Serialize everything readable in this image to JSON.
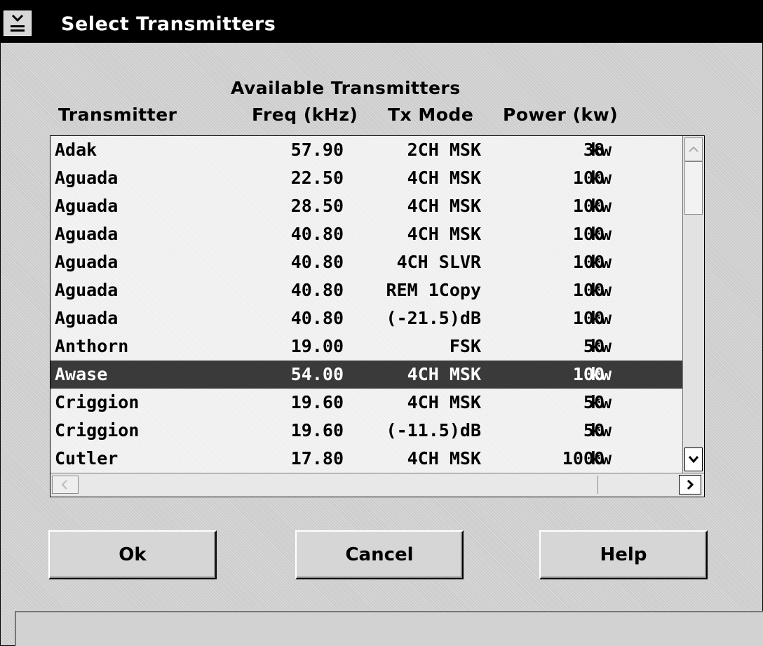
{
  "window": {
    "title": "Select Transmitters"
  },
  "list": {
    "group_title": "Available Transmitters",
    "headers": {
      "transmitter": "Transmitter",
      "freq": "Freq (kHz)",
      "mode": "Tx Mode",
      "power": "Power (kw)"
    },
    "rows": [
      {
        "name": "Adak",
        "freq": "57.90",
        "mode": "2CH MSK",
        "power": "38",
        "unit": "kw"
      },
      {
        "name": "Aguada",
        "freq": "22.50",
        "mode": "4CH MSK",
        "power": "100",
        "unit": "kw"
      },
      {
        "name": "Aguada",
        "freq": "28.50",
        "mode": "4CH MSK",
        "power": "100",
        "unit": "kw"
      },
      {
        "name": "Aguada",
        "freq": "40.80",
        "mode": "4CH MSK",
        "power": "100",
        "unit": "kw"
      },
      {
        "name": "Aguada",
        "freq": "40.80",
        "mode": "4CH SLVR",
        "power": "100",
        "unit": "kw"
      },
      {
        "name": "Aguada",
        "freq": "40.80",
        "mode": "REM 1Copy",
        "power": "100",
        "unit": "kw"
      },
      {
        "name": "Aguada",
        "freq": "40.80",
        "mode": "(-21.5)dB",
        "power": "100",
        "unit": "kw"
      },
      {
        "name": "Anthorn",
        "freq": "19.00",
        "mode": "FSK",
        "power": "50",
        "unit": "kw"
      },
      {
        "name": "Awase",
        "freq": "54.00",
        "mode": "4CH MSK",
        "power": "100",
        "unit": "kw"
      },
      {
        "name": "Criggion",
        "freq": "19.60",
        "mode": "4CH MSK",
        "power": "50",
        "unit": "kw"
      },
      {
        "name": "Criggion",
        "freq": "19.60",
        "mode": "(-11.5)dB",
        "power": "50",
        "unit": "kw"
      },
      {
        "name": "Cutler",
        "freq": "17.80",
        "mode": "4CH MSK",
        "power": "1000",
        "unit": "kw"
      }
    ],
    "selected_index": 8
  },
  "buttons": {
    "ok": "Ok",
    "cancel": "Cancel",
    "help": "Help"
  },
  "icons": {
    "system_menu": "system-menu-icon",
    "scroll_up": "arrow-up-icon",
    "scroll_down": "chevron-down-icon",
    "scroll_left": "arrow-left-icon",
    "scroll_right": "chevron-right-icon"
  },
  "colors": {
    "titlebar": "#000000",
    "selection": "#3a3a3a",
    "dialog": "#cbcbcb"
  }
}
